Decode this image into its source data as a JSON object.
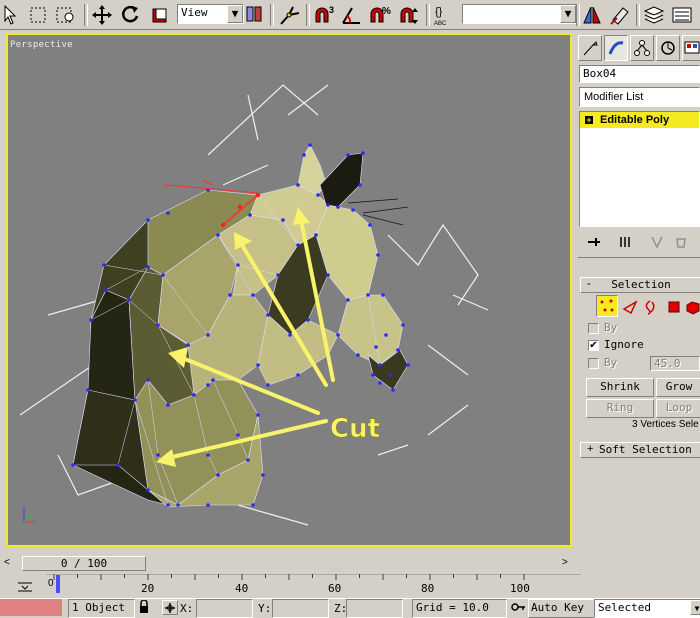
{
  "toolbar": {
    "view_combo": "View",
    "selection_set_combo": "",
    "abc_label": "ABC"
  },
  "viewport": {
    "label": "Perspective",
    "annotation": "Cut",
    "colors": {
      "frame": "#f5e91f",
      "background": "#808080",
      "annotation": "#f8f36a",
      "vertex": "#2a2aff"
    }
  },
  "command_panel": {
    "object_name": "Box04",
    "modifier_list": "Modifier List",
    "stack_item": "Editable Poly",
    "selection": {
      "title": "Selection",
      "by_vertex": "By",
      "ignore_backfacing": "Ignore",
      "by_angle": "By",
      "angle_value": "45.0",
      "shrink": "Shrink",
      "grow": "Grow",
      "ring": "Ring",
      "loop": "Loop",
      "status": "3 Vertices Sele"
    },
    "soft_selection": {
      "title": "Soft Selection"
    }
  },
  "timeline": {
    "frame_slider": "0 / 100",
    "ticks": [
      "0",
      "20",
      "40",
      "60",
      "80",
      "100"
    ]
  },
  "status_bar": {
    "selection_count": "1 Object",
    "x_label": "X:",
    "y_label": "Y:",
    "z_label": "Z:",
    "grid": "Grid = 10.0",
    "auto_key": "Auto Key",
    "selected": "Selected"
  }
}
